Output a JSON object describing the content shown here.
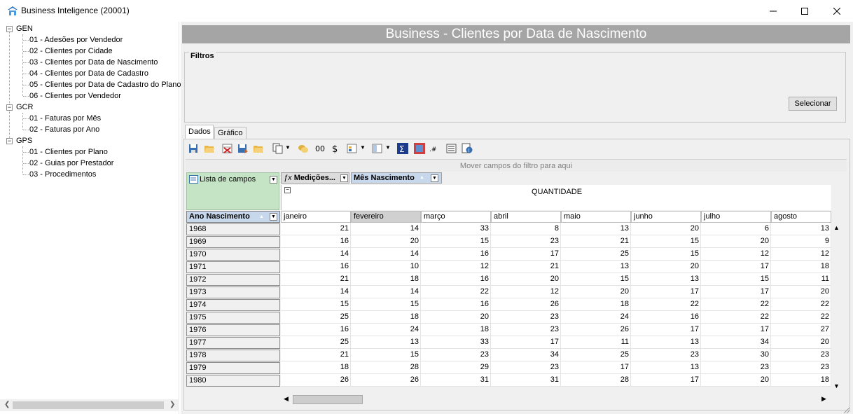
{
  "window": {
    "title": "Business Inteligence (20001)",
    "minimize": "—",
    "maximize": "☐",
    "close": "✕"
  },
  "tree": {
    "groups": [
      {
        "label": "GEN",
        "items": [
          "01 - Adesões por Vendedor",
          "02 - Clientes por Cidade",
          "03 - Clientes por Data de Nascimento",
          "04 - Clientes por Data de Cadastro",
          "05 - Clientes por Data de Cadastro do Plano",
          "06 - Clientes por Vendedor"
        ]
      },
      {
        "label": "GCR",
        "items": [
          "01 - Faturas por Mês",
          "02 - Faturas por Ano"
        ]
      },
      {
        "label": "GPS",
        "items": [
          "01 - Clientes por Plano",
          "02 - Guias por Prestador",
          "03 - Procedimentos"
        ]
      }
    ]
  },
  "report": {
    "title": "Business - Clientes por Data de Nascimento",
    "filters_label": "Filtros",
    "select_button": "Selecionar",
    "tabs": [
      "Dados",
      "Gráfico"
    ],
    "filter_drop_hint": "Mover campos do filtro para aqui",
    "field_list_label": "Lista de campos",
    "measures_field": "Medições...",
    "column_field": "Mês Nascimento",
    "measure_caption": "QUANTIDADE",
    "row_field": "Ano Nascimento",
    "toolbar_icons": [
      "save-layout-icon",
      "open-layout-icon",
      "delete-icon",
      "export-icon",
      "open-icon",
      "copy-icon",
      "group-icon",
      "link-icon",
      "dollar-icon",
      "filter-icon",
      "chart-view-icon",
      "sum-icon",
      "chart-icon",
      "decimal-format-icon",
      "list-icon",
      "info-icon"
    ]
  },
  "table": {
    "months": [
      "janeiro",
      "fevereiro",
      "março",
      "abril",
      "maio",
      "junho",
      "julho",
      "agosto"
    ],
    "selected_month": "fevereiro",
    "rows": [
      {
        "year": "1968",
        "values": [
          "21",
          "14",
          "33",
          "8",
          "13",
          "20",
          "6",
          "13"
        ]
      },
      {
        "year": "1969",
        "values": [
          "16",
          "20",
          "15",
          "23",
          "21",
          "15",
          "20",
          "9"
        ]
      },
      {
        "year": "1970",
        "values": [
          "14",
          "14",
          "16",
          "17",
          "25",
          "15",
          "12",
          "12"
        ]
      },
      {
        "year": "1971",
        "values": [
          "16",
          "10",
          "12",
          "21",
          "13",
          "20",
          "17",
          "18"
        ]
      },
      {
        "year": "1972",
        "values": [
          "21",
          "18",
          "16",
          "20",
          "15",
          "13",
          "15",
          "11"
        ]
      },
      {
        "year": "1973",
        "values": [
          "14",
          "14",
          "22",
          "12",
          "20",
          "17",
          "17",
          "20"
        ]
      },
      {
        "year": "1974",
        "values": [
          "15",
          "15",
          "16",
          "26",
          "18",
          "22",
          "22",
          "22"
        ]
      },
      {
        "year": "1975",
        "values": [
          "25",
          "18",
          "20",
          "23",
          "24",
          "16",
          "22",
          "22"
        ]
      },
      {
        "year": "1976",
        "values": [
          "16",
          "24",
          "18",
          "23",
          "26",
          "17",
          "17",
          "27"
        ]
      },
      {
        "year": "1977",
        "values": [
          "25",
          "13",
          "33",
          "17",
          "11",
          "13",
          "34",
          "20"
        ]
      },
      {
        "year": "1978",
        "values": [
          "21",
          "15",
          "23",
          "34",
          "25",
          "23",
          "30",
          "23"
        ]
      },
      {
        "year": "1979",
        "values": [
          "18",
          "28",
          "29",
          "23",
          "17",
          "13",
          "23",
          "23"
        ]
      },
      {
        "year": "1980",
        "values": [
          "26",
          "26",
          "31",
          "31",
          "28",
          "17",
          "20",
          "18"
        ]
      }
    ]
  },
  "colors": {
    "header_bar": "#a5a5a5",
    "field_list_bg": "#c5e3c5",
    "row_field_bg": "#c8d8ec"
  }
}
